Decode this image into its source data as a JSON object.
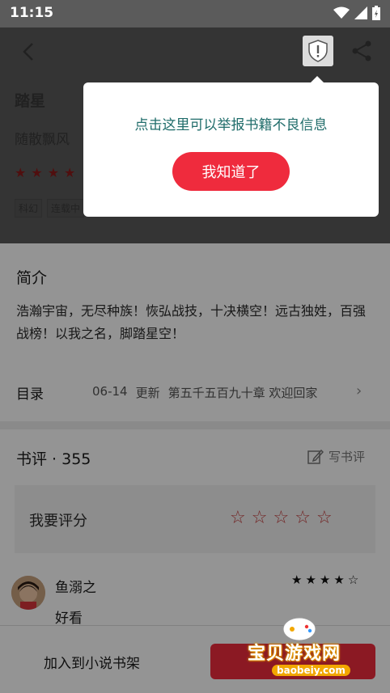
{
  "status_bar": {
    "time": "11:15"
  },
  "book": {
    "title": "踏星",
    "author": "随散飘风",
    "tags": [
      "科幻",
      "连载中"
    ]
  },
  "intro": {
    "title": "简介",
    "text": "浩瀚宇宙，无尽种族！恢弘战技，十决横空！远古独姓，百强战榜！以我之名，脚踏星空！"
  },
  "catalog": {
    "label": "目录",
    "date": "06-14",
    "update_label": "更新",
    "latest_chapter": "第五千五百九十章 欢迎回家"
  },
  "reviews": {
    "title": "书评 · 355",
    "write_label": "写书评",
    "rate_label": "我要评分",
    "items": [
      {
        "user": "鱼溺之",
        "text": "好看",
        "rating": 4
      }
    ]
  },
  "bottom": {
    "add_shelf_label": "加入到小说书架"
  },
  "popup": {
    "message": "点击这里可以举报书籍不良信息",
    "confirm_label": "我知道了"
  },
  "watermark": {
    "text": "宝贝游戏网",
    "url": "baobeiy.com"
  },
  "colors": {
    "accent_red": "#ef2b3d",
    "popup_text": "#1f6c6a",
    "header_bg": "#5b5b5b"
  }
}
